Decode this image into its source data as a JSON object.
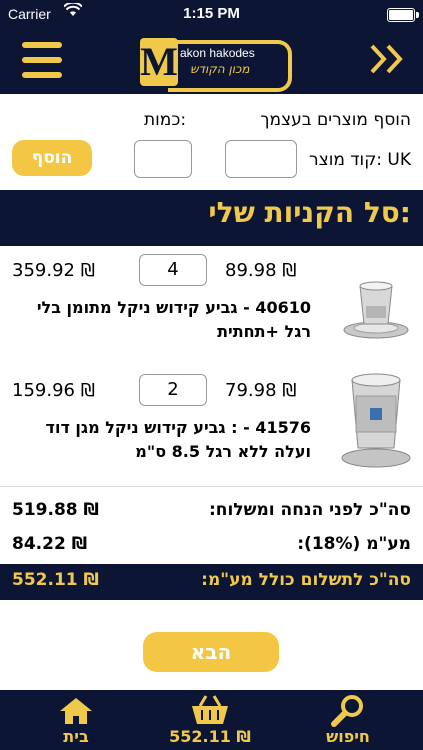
{
  "status_bar": {
    "carrier": "Carrier",
    "time": "1:15 PM"
  },
  "logo": {
    "text_en": "akon hakodes",
    "text_he": "מכון הקודש"
  },
  "add_section": {
    "title": "הוסף מוצרים בעצמך",
    "quantity_label": "כמות:",
    "product_code_label": "קוד מוצר: UK",
    "add_button": "הוסף"
  },
  "cart": {
    "title": "סל הקניות שלי:",
    "items": [
      {
        "unit_price": "89.98 ₪",
        "quantity": "4",
        "line_total": "359.92 ₪",
        "description": "40610 - גביע קידוש ניקל מתומן בלי רגל +תחתית"
      },
      {
        "unit_price": "79.98 ₪",
        "quantity": "2",
        "line_total": "159.96 ₪",
        "description": "41576 - : גביע קידוש ניקל מגן דוד ועלה ללא רגל 8.5 ס\"מ"
      }
    ]
  },
  "totals": {
    "subtotal_label": "סה\"כ לפני הנחה ומשלוח:",
    "subtotal_value": "519.88 ₪",
    "vat_label": "מע\"מ (18%):",
    "vat_value": "84.22 ₪",
    "grand_label": "סה\"כ לתשלום כולל מע\"מ:",
    "grand_value": "552.11 ₪"
  },
  "next_button": "הבא",
  "tabbar": {
    "home_label": "בית",
    "cart_label": "552.11 ₪",
    "search_label": "חיפוש"
  },
  "colors": {
    "navy": "#0c1634",
    "gold": "#f0c94a"
  }
}
